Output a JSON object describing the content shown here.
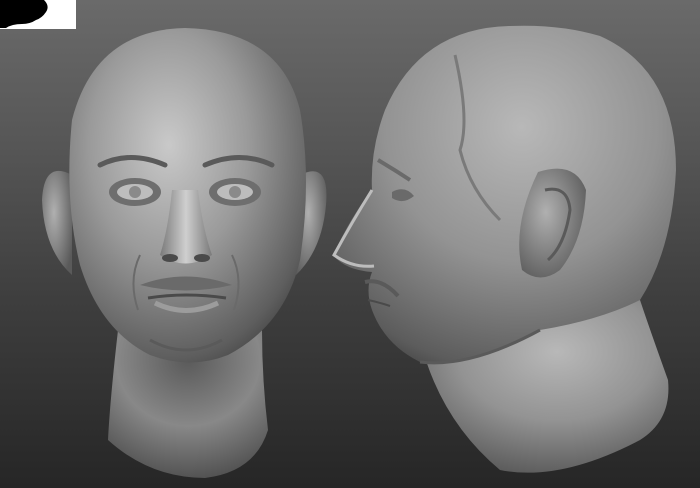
{
  "viewport": {
    "background_top": "#6a6a6a",
    "background_bottom": "#262626",
    "material_color": "#8e8e8e",
    "material_highlight": "#c8c8c8",
    "material_shadow": "#3a3a3a"
  },
  "navigator": {
    "icon": "head-silhouette-icon",
    "background": "#ffffff",
    "silhouette": "#000000"
  },
  "models": [
    {
      "id": "front",
      "view": "front"
    },
    {
      "id": "profile",
      "view": "side-right"
    }
  ]
}
